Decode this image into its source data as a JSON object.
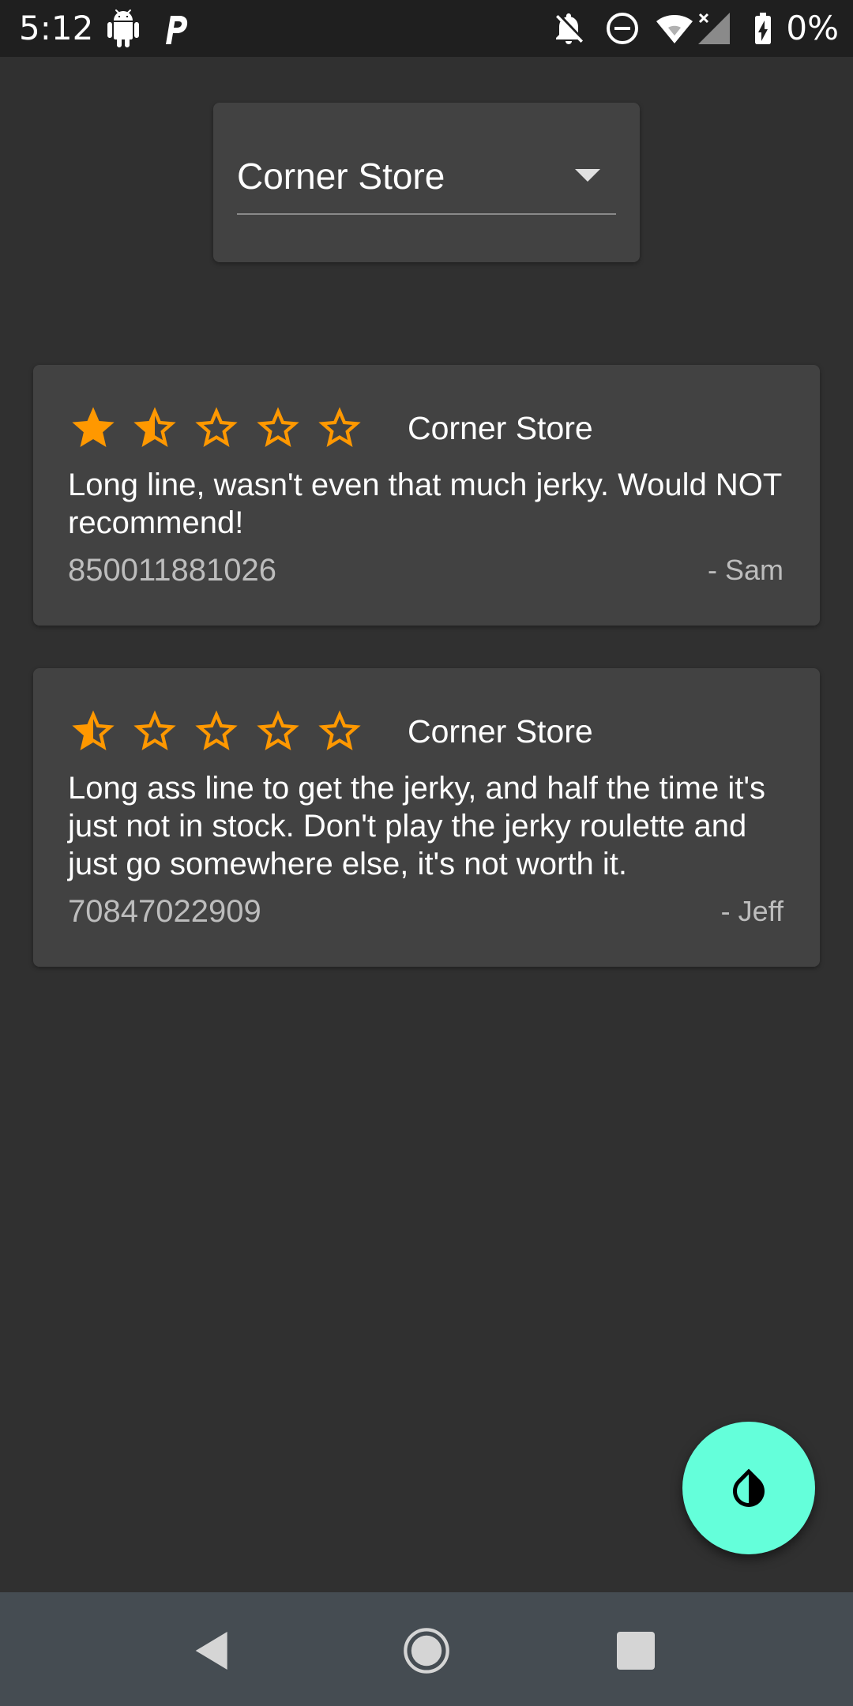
{
  "status_bar": {
    "time": "5:12",
    "battery_percent": "0%",
    "icons": [
      "android-icon",
      "p-icon",
      "notifications-off-icon",
      "do-not-disturb-icon",
      "wifi-icon",
      "cell-signal-icon",
      "battery-charging-icon"
    ]
  },
  "store_selector": {
    "selected": "Corner Store"
  },
  "reviews": [
    {
      "rating": 1.5,
      "store": "Corner Store",
      "text": "Long line, wasn't even that much jerky. Would NOT recommend!",
      "code": "850011881026",
      "author": "- Sam"
    },
    {
      "rating": 0.5,
      "store": "Corner Store",
      "text": "Long ass line to get the jerky, and half the time it's just not in stock. Don't play the jerky roulette and just go somewhere else, it's not worth it.",
      "code": "70847022909",
      "author": "- Jeff"
    }
  ],
  "fab": {
    "icon": "invert-colors-icon"
  },
  "nav_bar": {
    "icons": [
      "back-icon",
      "home-icon",
      "recents-icon"
    ]
  },
  "colors": {
    "background": "#303030",
    "card": "#424242",
    "star": "#ff9800",
    "fab": "#64ffda",
    "nav_bar": "#454c52"
  }
}
